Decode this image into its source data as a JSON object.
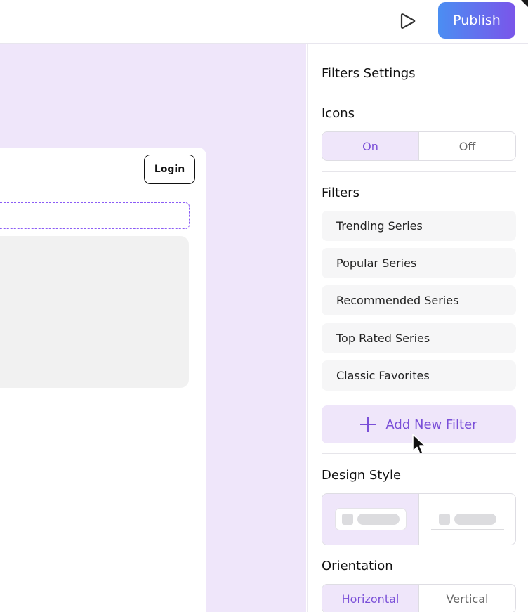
{
  "topbar": {
    "publish_label": "Publish"
  },
  "canvas": {
    "login_label": "Login"
  },
  "panel": {
    "title": "Filters Settings",
    "icons": {
      "label": "Icons",
      "options": [
        "On",
        "Off"
      ],
      "selected": "On"
    },
    "filters": {
      "label": "Filters",
      "items": [
        "Trending Series",
        "Popular Series",
        "Recommended Series",
        "Top Rated Series",
        "Classic Favorites"
      ],
      "add_label": "Add New Filter"
    },
    "design_style": {
      "label": "Design Style",
      "selected_index": 0
    },
    "orientation": {
      "label": "Orientation",
      "options": [
        "Horizontal",
        "Vertical"
      ],
      "selected": "Horizontal"
    }
  },
  "colors": {
    "accent": "#7a4fd8",
    "accent_light": "#efe6fa",
    "publish_gradient_start": "#4b8ef2",
    "publish_gradient_end": "#7a55ea"
  }
}
